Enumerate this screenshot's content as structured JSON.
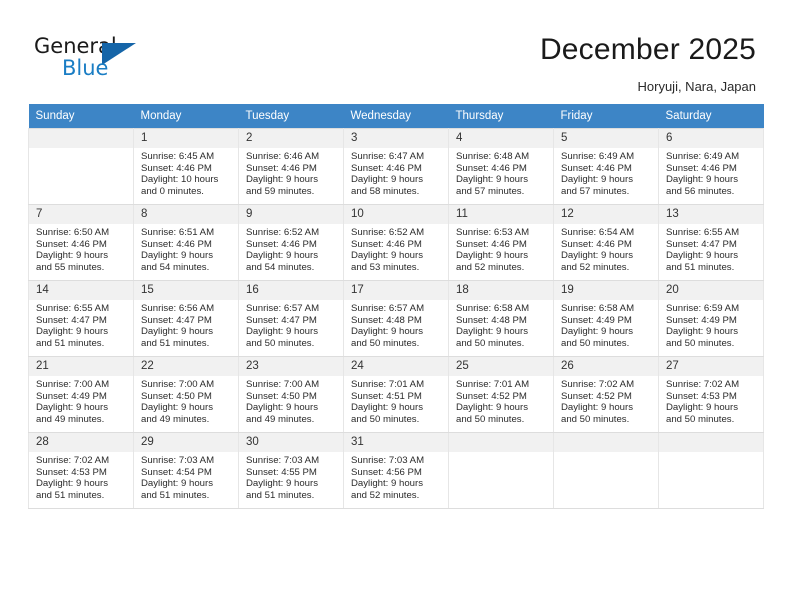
{
  "header": {
    "logo": {
      "word1": "General",
      "word2": "Blue",
      "triangle_color": "#1565a8",
      "blue_color": "#1a7dc4"
    },
    "title": "December 2025",
    "subtitle": "Horyuji, Nara, Japan"
  },
  "calendar": {
    "header_bg": "#3d85c6",
    "weekday_headers": [
      "Sunday",
      "Monday",
      "Tuesday",
      "Wednesday",
      "Thursday",
      "Friday",
      "Saturday"
    ],
    "weeks": [
      [
        {
          "day": "",
          "lines": []
        },
        {
          "day": "1",
          "lines": [
            "Sunrise: 6:45 AM",
            "Sunset: 4:46 PM",
            "Daylight: 10 hours",
            "and 0 minutes."
          ]
        },
        {
          "day": "2",
          "lines": [
            "Sunrise: 6:46 AM",
            "Sunset: 4:46 PM",
            "Daylight: 9 hours",
            "and 59 minutes."
          ]
        },
        {
          "day": "3",
          "lines": [
            "Sunrise: 6:47 AM",
            "Sunset: 4:46 PM",
            "Daylight: 9 hours",
            "and 58 minutes."
          ]
        },
        {
          "day": "4",
          "lines": [
            "Sunrise: 6:48 AM",
            "Sunset: 4:46 PM",
            "Daylight: 9 hours",
            "and 57 minutes."
          ]
        },
        {
          "day": "5",
          "lines": [
            "Sunrise: 6:49 AM",
            "Sunset: 4:46 PM",
            "Daylight: 9 hours",
            "and 57 minutes."
          ]
        },
        {
          "day": "6",
          "lines": [
            "Sunrise: 6:49 AM",
            "Sunset: 4:46 PM",
            "Daylight: 9 hours",
            "and 56 minutes."
          ]
        }
      ],
      [
        {
          "day": "7",
          "lines": [
            "Sunrise: 6:50 AM",
            "Sunset: 4:46 PM",
            "Daylight: 9 hours",
            "and 55 minutes."
          ]
        },
        {
          "day": "8",
          "lines": [
            "Sunrise: 6:51 AM",
            "Sunset: 4:46 PM",
            "Daylight: 9 hours",
            "and 54 minutes."
          ]
        },
        {
          "day": "9",
          "lines": [
            "Sunrise: 6:52 AM",
            "Sunset: 4:46 PM",
            "Daylight: 9 hours",
            "and 54 minutes."
          ]
        },
        {
          "day": "10",
          "lines": [
            "Sunrise: 6:52 AM",
            "Sunset: 4:46 PM",
            "Daylight: 9 hours",
            "and 53 minutes."
          ]
        },
        {
          "day": "11",
          "lines": [
            "Sunrise: 6:53 AM",
            "Sunset: 4:46 PM",
            "Daylight: 9 hours",
            "and 52 minutes."
          ]
        },
        {
          "day": "12",
          "lines": [
            "Sunrise: 6:54 AM",
            "Sunset: 4:46 PM",
            "Daylight: 9 hours",
            "and 52 minutes."
          ]
        },
        {
          "day": "13",
          "lines": [
            "Sunrise: 6:55 AM",
            "Sunset: 4:47 PM",
            "Daylight: 9 hours",
            "and 51 minutes."
          ]
        }
      ],
      [
        {
          "day": "14",
          "lines": [
            "Sunrise: 6:55 AM",
            "Sunset: 4:47 PM",
            "Daylight: 9 hours",
            "and 51 minutes."
          ]
        },
        {
          "day": "15",
          "lines": [
            "Sunrise: 6:56 AM",
            "Sunset: 4:47 PM",
            "Daylight: 9 hours",
            "and 51 minutes."
          ]
        },
        {
          "day": "16",
          "lines": [
            "Sunrise: 6:57 AM",
            "Sunset: 4:47 PM",
            "Daylight: 9 hours",
            "and 50 minutes."
          ]
        },
        {
          "day": "17",
          "lines": [
            "Sunrise: 6:57 AM",
            "Sunset: 4:48 PM",
            "Daylight: 9 hours",
            "and 50 minutes."
          ]
        },
        {
          "day": "18",
          "lines": [
            "Sunrise: 6:58 AM",
            "Sunset: 4:48 PM",
            "Daylight: 9 hours",
            "and 50 minutes."
          ]
        },
        {
          "day": "19",
          "lines": [
            "Sunrise: 6:58 AM",
            "Sunset: 4:49 PM",
            "Daylight: 9 hours",
            "and 50 minutes."
          ]
        },
        {
          "day": "20",
          "lines": [
            "Sunrise: 6:59 AM",
            "Sunset: 4:49 PM",
            "Daylight: 9 hours",
            "and 50 minutes."
          ]
        }
      ],
      [
        {
          "day": "21",
          "lines": [
            "Sunrise: 7:00 AM",
            "Sunset: 4:49 PM",
            "Daylight: 9 hours",
            "and 49 minutes."
          ]
        },
        {
          "day": "22",
          "lines": [
            "Sunrise: 7:00 AM",
            "Sunset: 4:50 PM",
            "Daylight: 9 hours",
            "and 49 minutes."
          ]
        },
        {
          "day": "23",
          "lines": [
            "Sunrise: 7:00 AM",
            "Sunset: 4:50 PM",
            "Daylight: 9 hours",
            "and 49 minutes."
          ]
        },
        {
          "day": "24",
          "lines": [
            "Sunrise: 7:01 AM",
            "Sunset: 4:51 PM",
            "Daylight: 9 hours",
            "and 50 minutes."
          ]
        },
        {
          "day": "25",
          "lines": [
            "Sunrise: 7:01 AM",
            "Sunset: 4:52 PM",
            "Daylight: 9 hours",
            "and 50 minutes."
          ]
        },
        {
          "day": "26",
          "lines": [
            "Sunrise: 7:02 AM",
            "Sunset: 4:52 PM",
            "Daylight: 9 hours",
            "and 50 minutes."
          ]
        },
        {
          "day": "27",
          "lines": [
            "Sunrise: 7:02 AM",
            "Sunset: 4:53 PM",
            "Daylight: 9 hours",
            "and 50 minutes."
          ]
        }
      ],
      [
        {
          "day": "28",
          "lines": [
            "Sunrise: 7:02 AM",
            "Sunset: 4:53 PM",
            "Daylight: 9 hours",
            "and 51 minutes."
          ]
        },
        {
          "day": "29",
          "lines": [
            "Sunrise: 7:03 AM",
            "Sunset: 4:54 PM",
            "Daylight: 9 hours",
            "and 51 minutes."
          ]
        },
        {
          "day": "30",
          "lines": [
            "Sunrise: 7:03 AM",
            "Sunset: 4:55 PM",
            "Daylight: 9 hours",
            "and 51 minutes."
          ]
        },
        {
          "day": "31",
          "lines": [
            "Sunrise: 7:03 AM",
            "Sunset: 4:56 PM",
            "Daylight: 9 hours",
            "and 52 minutes."
          ]
        },
        {
          "day": "",
          "lines": []
        },
        {
          "day": "",
          "lines": []
        },
        {
          "day": "",
          "lines": []
        }
      ]
    ]
  }
}
